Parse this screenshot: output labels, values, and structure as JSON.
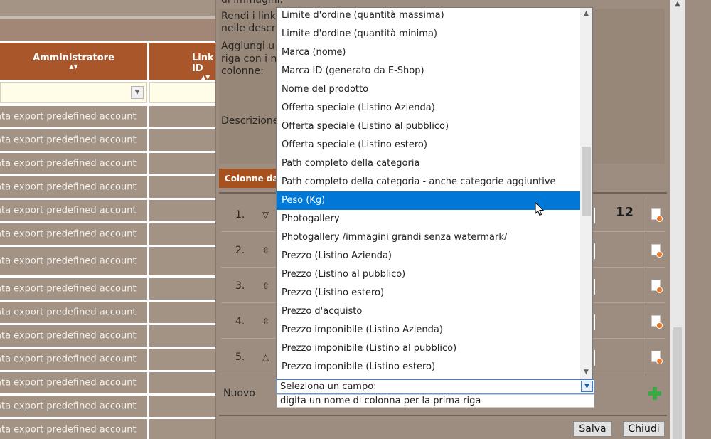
{
  "background_table": {
    "header_administrator": "Amministratore",
    "header_link_id": "Link ID",
    "sort_arrows": "▲▼",
    "rows": [
      "ata export predefined account",
      "ata export predefined account",
      "ata export predefined account",
      "ata export predefined account",
      "ata export predefined account",
      "ata export predefined account",
      "ata export predefined account",
      "ata export predefined account",
      "ata export predefined account",
      "ata export predefined account",
      "ata export predefined account",
      "ata export predefined account",
      "ata export predefined account",
      "ata export predefined account"
    ]
  },
  "modal": {
    "text_top": "di immagini.",
    "text_link_1": "Rendi i link",
    "text_link_2": "nelle descri",
    "text_add_1": "Aggiungi u",
    "text_add_2": "riga con i n",
    "text_add_3": "colonne:",
    "text_description": "Descrizione",
    "columns_header": "Colonne da",
    "row_numbers": [
      "1.",
      "2.",
      "3.",
      "4.",
      "5."
    ],
    "row1_value": "12",
    "new_label": "Nuovo",
    "select_value": "Seleziona un campo:",
    "hint_value": "digita un nome di colonna per la prima riga",
    "save_label": "Salva",
    "close_label": "Chiudi"
  },
  "dropdown": {
    "options": [
      "Limite d'ordine (quantità massima)",
      "Limite d'ordine (quantità minima)",
      "Marca (nome)",
      "Marca ID (generato da E-Shop)",
      "Nome del prodotto",
      "Offerta speciale (Listino Azienda)",
      "Offerta speciale (Listino al pubblico)",
      "Offerta speciale (Listino estero)",
      "Path completo della categoria",
      "Path completo della categoria - anche categorie aggiuntive",
      "Peso (Kg)",
      "Photogallery",
      "Photogallery /immagini grandi senza watermark/",
      "Prezzo (Listino Azienda)",
      "Prezzo (Listino al pubblico)",
      "Prezzo (Listino estero)",
      "Prezzo d'acquisto",
      "Prezzo imponibile (Listino Azienda)",
      "Prezzo imponibile (Listino al pubblico)",
      "Prezzo imponibile (Listino estero)"
    ],
    "selected": "Peso (Kg)"
  },
  "icons": {
    "row_action": "document-remove-icon",
    "add": "plus-icon",
    "updown": "sort-updown-icon"
  }
}
